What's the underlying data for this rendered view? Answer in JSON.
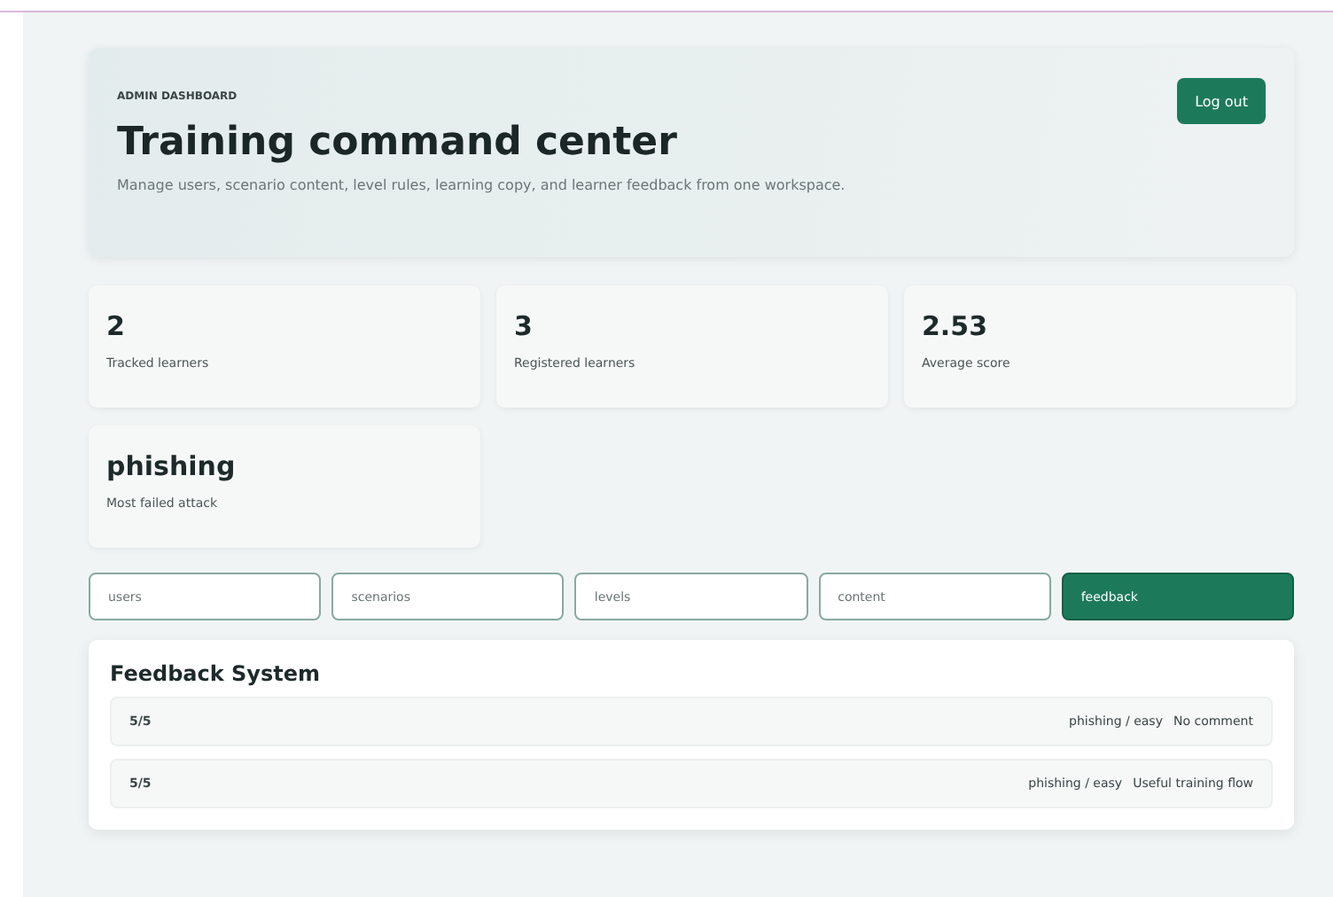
{
  "header": {
    "eyebrow": "ADMIN DASHBOARD",
    "title": "Training command center",
    "description": "Manage users, scenario content, level rules, learning copy, and learner feedback from one workspace.",
    "logout": "Log out"
  },
  "stats": [
    {
      "value": "2",
      "label": "Tracked learners"
    },
    {
      "value": "3",
      "label": "Registered learners"
    },
    {
      "value": "2.53",
      "label": "Average score"
    },
    {
      "value": "phishing",
      "label": "Most failed attack"
    }
  ],
  "tabs": [
    {
      "label": "users",
      "selected": false
    },
    {
      "label": "scenarios",
      "selected": false
    },
    {
      "label": "levels",
      "selected": false
    },
    {
      "label": "content",
      "selected": false
    },
    {
      "label": "feedback",
      "selected": true
    }
  ],
  "feedback": {
    "title": "Feedback System",
    "rows": [
      {
        "score": "5/5",
        "scenario": "phishing / easy",
        "comment": "No comment"
      },
      {
        "score": "5/5",
        "scenario": "phishing / easy",
        "comment": "Useful training flow"
      }
    ]
  }
}
